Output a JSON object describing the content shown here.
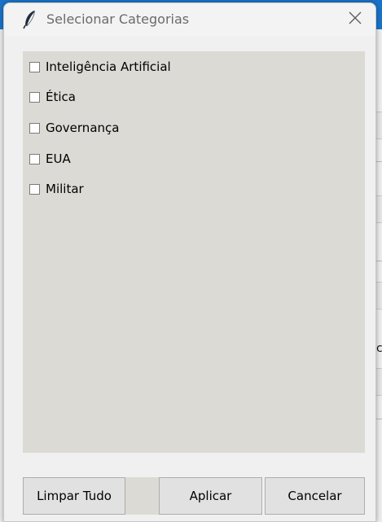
{
  "window": {
    "title": "Selecionar Categorias",
    "icon": "feather-icon",
    "close_icon": "close-icon"
  },
  "categories": [
    {
      "label": "Inteligência Artificial",
      "checked": false
    },
    {
      "label": "Ética",
      "checked": false
    },
    {
      "label": "Governança",
      "checked": false
    },
    {
      "label": "EUA",
      "checked": false
    },
    {
      "label": "Militar",
      "checked": false
    }
  ],
  "buttons": {
    "clear_label": "Limpar Tudo",
    "apply_label": "Aplicar",
    "cancel_label": "Cancelar"
  },
  "background": {
    "cut_text": "c"
  },
  "colors": {
    "panel": "#dcdad5",
    "window": "#f0f0f0",
    "button": "#e1e1e1",
    "title_text": "#6a6a6a",
    "background_bar": "#1a73c8"
  }
}
